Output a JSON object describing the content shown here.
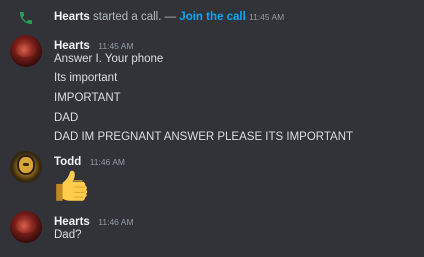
{
  "system_message": {
    "author": "Hearts",
    "action": " started a call. — ",
    "join_label": "Join the call",
    "timestamp": "11:45 AM",
    "icon": "phone-icon",
    "icon_color": "#23a55a"
  },
  "messages": [
    {
      "author": "Hearts",
      "timestamp": "11:45 AM",
      "lines": [
        "Answer I. Your phone",
        "Its important",
        "IMPORTANT",
        "DAD",
        "DAD IM PREGNANT ANSWER PLEASE ITS IMPORTANT"
      ]
    },
    {
      "author": "Todd",
      "timestamp": "11:46 AM",
      "emoji": "thumbs-up"
    },
    {
      "author": "Hearts",
      "timestamp": "11:46 AM",
      "lines": [
        "Dad?"
      ]
    }
  ],
  "colors": {
    "background": "#313338",
    "link": "#00a8fc",
    "text": "#dbdee1",
    "muted": "#949ba4"
  }
}
